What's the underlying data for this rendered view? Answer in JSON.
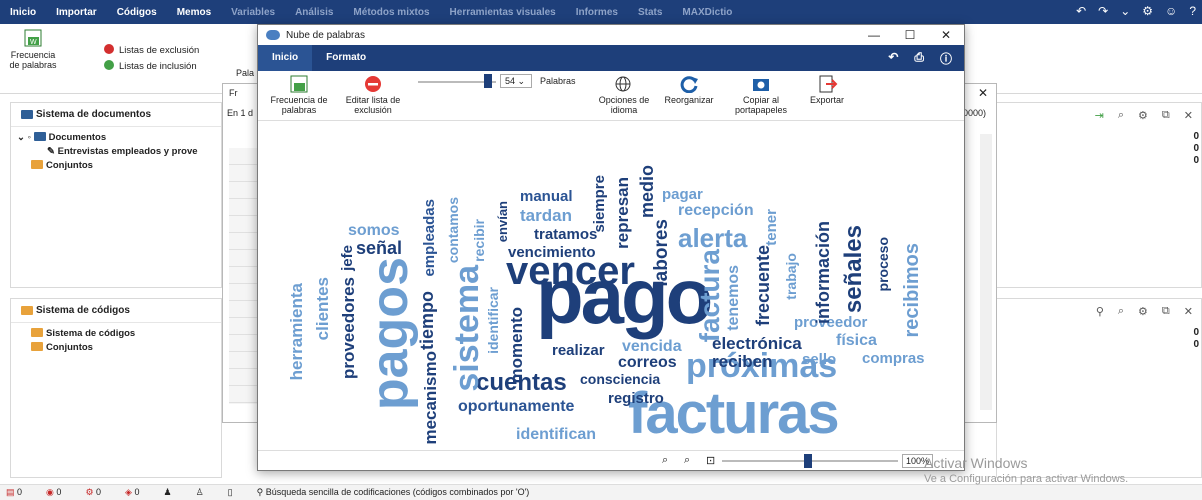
{
  "menu": [
    "Inicio",
    "Importar",
    "Códigos",
    "Memos",
    "Variables",
    "Análisis",
    "Métodos mixtos",
    "Herramientas visuales",
    "Informes",
    "Stats",
    "MAXDictio"
  ],
  "ribbon": {
    "word_freq": "Frecuencia de palabras",
    "exclusion": "Listas de exclusión",
    "inclusion": "Listas de inclusión",
    "partial": "Pala"
  },
  "doc_panel": {
    "title": "Sistema de documentos",
    "root": "Documentos",
    "item": "Entrevistas empleados y prove",
    "sets": "Conjuntos"
  },
  "code_panel": {
    "title": "Sistema de códigos",
    "root": "Sistema de códigos",
    "sets": "Conjuntos"
  },
  "bg_window": {
    "title_partial": "Fr",
    "row_text": "En 1 d",
    "value": ",0000)"
  },
  "status": {
    "counts": [
      "0",
      "0",
      "0",
      "0"
    ],
    "search": "Búsqueda sencilla de codificaciones (códigos combinados por 'O')"
  },
  "watermark": {
    "line1": "Activar Windows",
    "line2": "Ve a Configuración para activar Windows."
  },
  "colors": {
    "dark": "#1e3f7a",
    "mid": "#2b5494",
    "light": "#6d9ed1"
  },
  "cloud_window": {
    "title": "Nube de palabras",
    "tabs": [
      "Inicio",
      "Formato"
    ],
    "buttons": {
      "freq": "Frecuencia de palabras",
      "edit": "Editar lista de exclusión",
      "options": "Opciones de idioma",
      "reorg": "Reorganizar",
      "copy": "Copiar al portapapeles",
      "export": "Exportar"
    },
    "count_value": "54",
    "count_label": "Palabras",
    "zoom": "100%"
  },
  "words": {
    "pago": "pago",
    "facturas": "facturas",
    "pagos": "pagos",
    "vencer": "vencer",
    "próximas": "próximas",
    "cuentas": "cuentas",
    "sistema": "sistema",
    "factura": "factura",
    "alerta": "alerta",
    "vencimiento": "vencimiento",
    "oportunamente": "oportunamente",
    "identifican": "identifican",
    "electrónica": "electrónica",
    "reciben": "reciben",
    "sello": "sello",
    "compras": "compras",
    "física": "física",
    "proveedor": "proveedor",
    "recibimos": "recibimos",
    "señales": "señales",
    "proceso": "proceso",
    "información": "información",
    "trabajo": "trabajo",
    "frecuente": "frecuente",
    "tenemos": "tenemos",
    "tener": "tener",
    "recepción": "recepción",
    "pagar": "pagar",
    "medio": "medio",
    "labores": "labores",
    "represan": "represan",
    "siempre": "siempre",
    "manual": "manual",
    "tardan": "tardan",
    "tratamos": "tratamos",
    "envían": "envían",
    "recibir": "recibir",
    "contamos": "contamos",
    "empleadas": "empleadas",
    "somos": "somos",
    "señal": "señal",
    "jefe": "jefe",
    "proveedores": "proveedores",
    "clientes": "clientes",
    "herramienta": "herramienta",
    "tiempo": "tiempo",
    "mecanismo": "mecanismo",
    "identificar": "identificar",
    "momento": "momento",
    "realizar": "realizar",
    "vencida": "vencida",
    "correos": "correos",
    "consciencia": "consciencia",
    "registro": "registro"
  }
}
